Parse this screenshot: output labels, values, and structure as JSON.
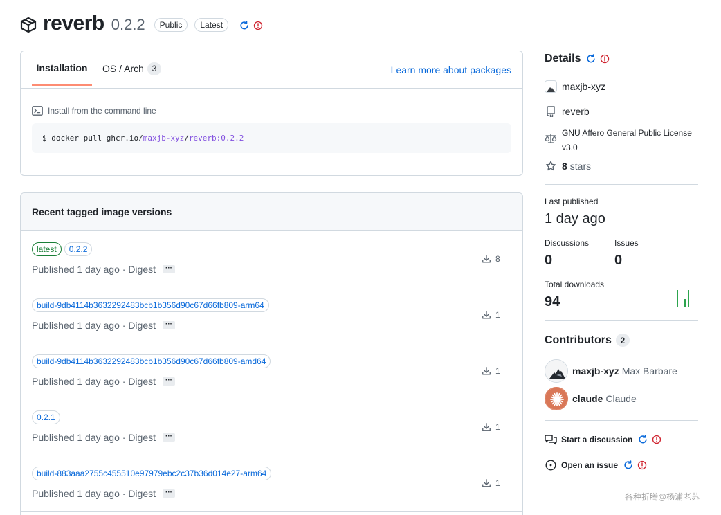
{
  "header": {
    "package_name": "reverb",
    "version": "0.2.2",
    "labels": [
      "Public",
      "Latest"
    ],
    "icons": [
      "package-icon",
      "refresh-icon",
      "alert-icon"
    ]
  },
  "install": {
    "tabs": [
      {
        "label": "Installation"
      },
      {
        "label": "OS / Arch",
        "count": "3"
      }
    ],
    "learn_link": "Learn more about packages",
    "command_title": "Install from the command line",
    "command": {
      "prefix": "$ docker pull ghcr.io/",
      "owner": "maxjb-xyz",
      "slash": "/",
      "image_ref": "reverb:0.2.2"
    }
  },
  "versions": {
    "title": "Recent tagged image versions",
    "rows": [
      {
        "tags": [
          "latest",
          "0.2.2"
        ],
        "published": "Published 1 day ago · Digest",
        "downloads": "8"
      },
      {
        "tags": [
          "build-9db4114b3632292483bcb1b356d90c67d66fb809-arm64"
        ],
        "published": "Published 1 day ago · Digest",
        "downloads": "1"
      },
      {
        "tags": [
          "build-9db4114b3632292483bcb1b356d90c67d66fb809-amd64"
        ],
        "published": "Published 1 day ago · Digest",
        "downloads": "1"
      },
      {
        "tags": [
          "0.2.1"
        ],
        "published": "Published 1 day ago · Digest",
        "downloads": "1"
      },
      {
        "tags": [
          "build-883aaa2755c455510e97979ebc2c37b36d014e27-arm64"
        ],
        "published": "Published 1 day ago · Digest",
        "downloads": "1"
      }
    ],
    "ellipsis": "···"
  },
  "sidebar": {
    "details_title": "Details",
    "owner": "maxjb-xyz",
    "repo": "reverb",
    "license": "GNU Affero General Public License v3.0",
    "stars_count": "8",
    "stars_label": "stars",
    "last_published_label": "Last published",
    "last_published_value": "1 day ago",
    "discussions_label": "Discussions",
    "discussions_value": "0",
    "issues_label": "Issues",
    "issues_value": "0",
    "total_downloads_label": "Total downloads",
    "total_downloads_value": "94",
    "contributors_title": "Contributors",
    "contributors_count": "2",
    "contributors": [
      {
        "login": "maxjb-xyz",
        "name": "Max Barbare"
      },
      {
        "login": "claude",
        "name": "Claude"
      }
    ],
    "start_discussion": "Start a discussion",
    "open_issue": "Open an issue"
  },
  "colors": {
    "accent_blue": "#0969da",
    "tab_underline": "#fd8c73",
    "latest_green": "#1a7f37",
    "alert_red": "#cf222e",
    "spark_green": "#2da44e",
    "claude_orange": "#d97757"
  },
  "watermark": "各种折腾@杨浦老苏"
}
